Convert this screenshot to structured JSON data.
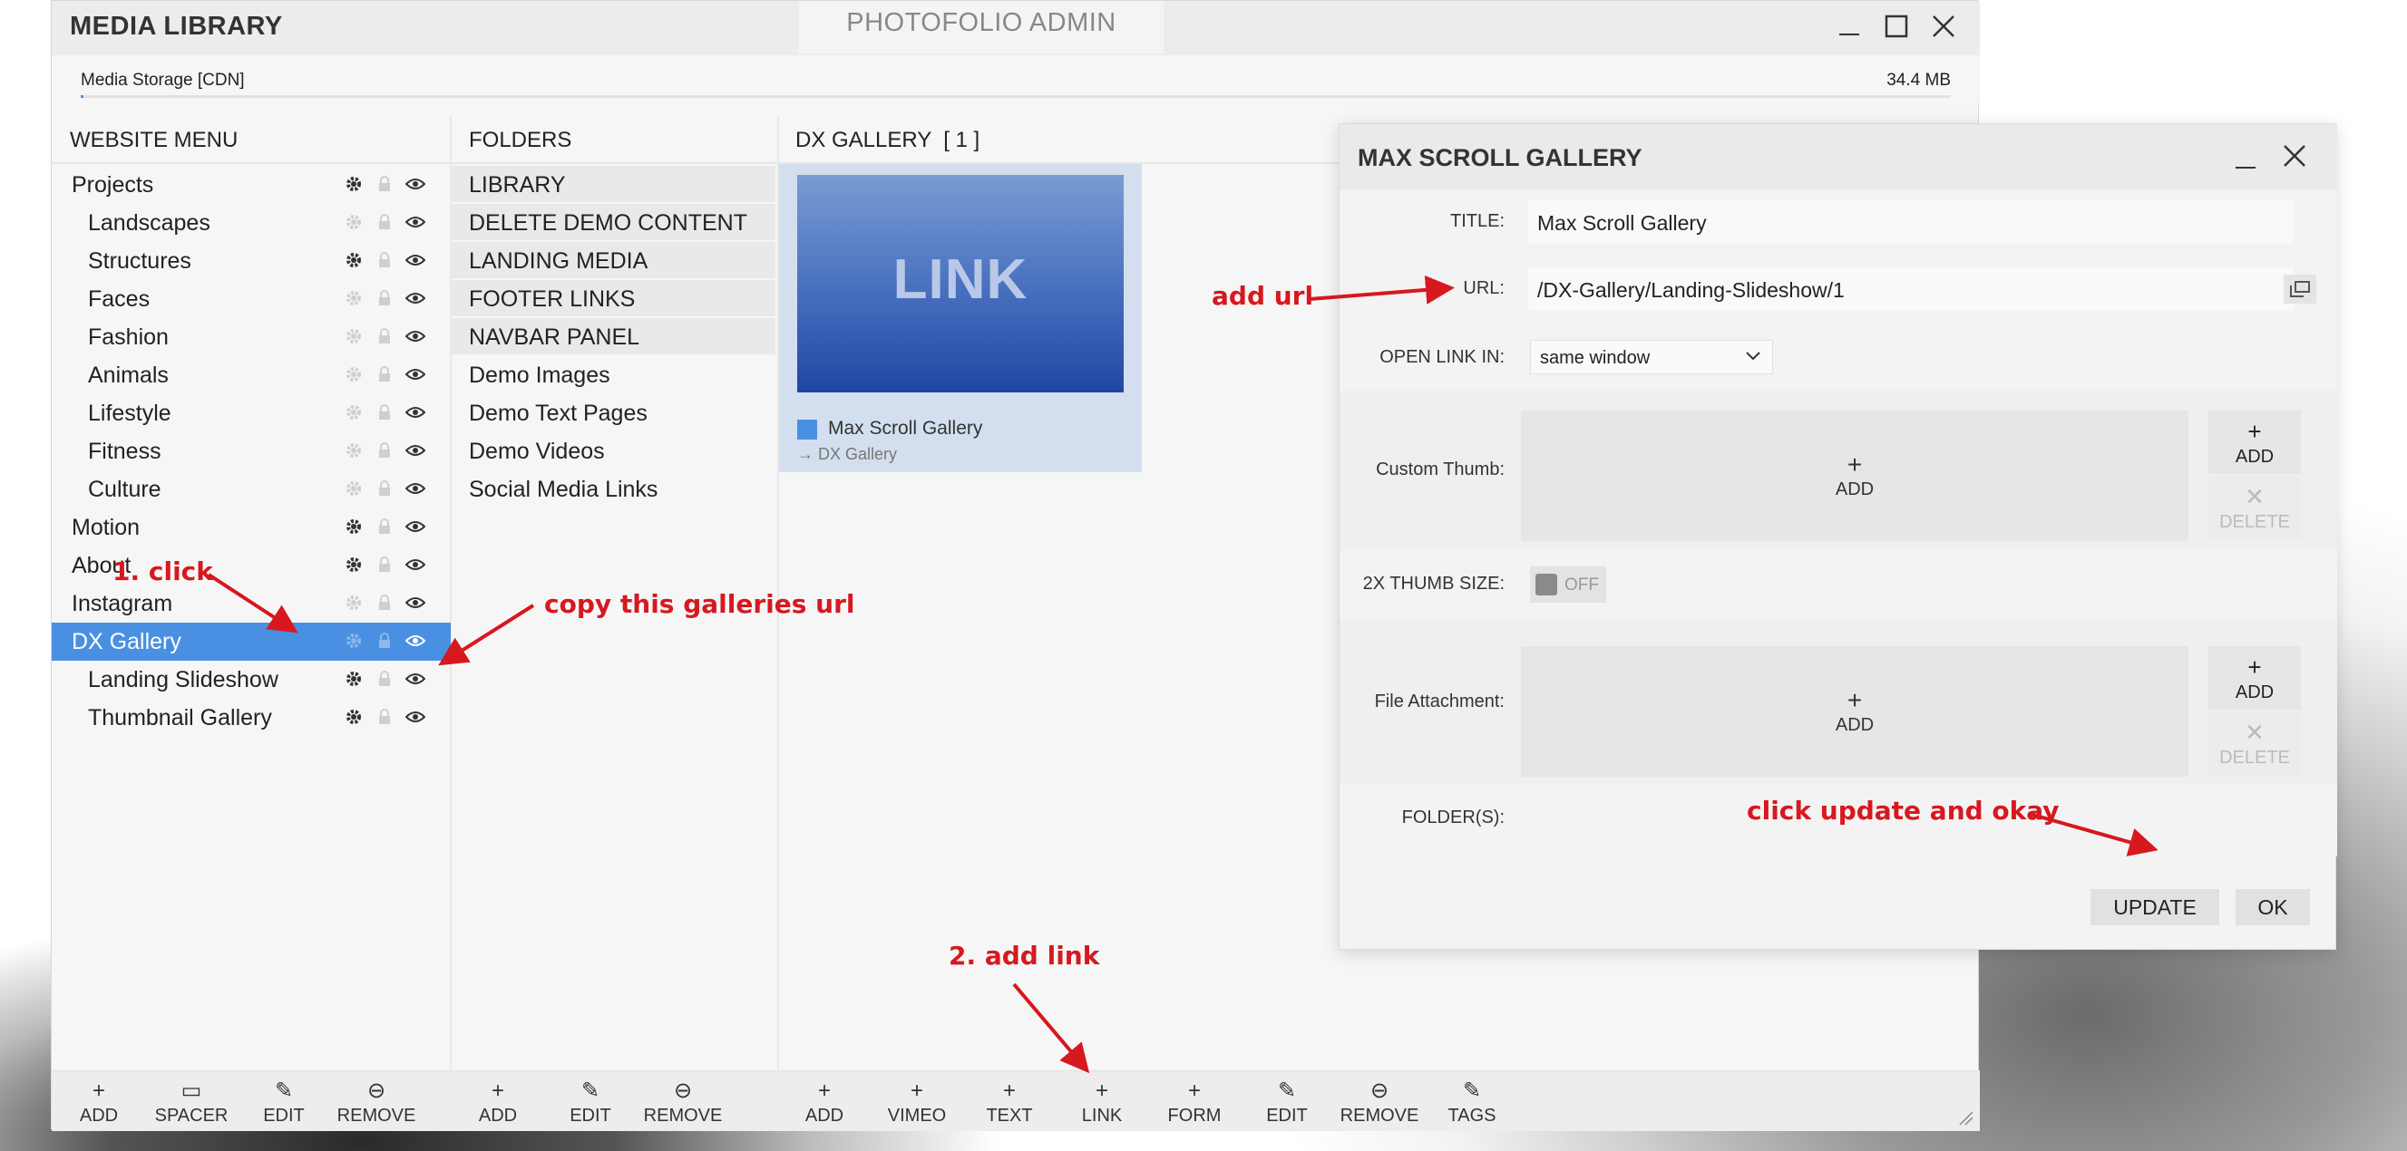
{
  "window": {
    "app_title": "MEDIA LIBRARY",
    "center_title": "PHOTOFOLIO ADMIN",
    "controls": {
      "minimize": "minimize-icon",
      "maximize": "maximize-icon",
      "close": "close-icon"
    }
  },
  "storage": {
    "label": "Media Storage [CDN]",
    "size": "34.4 MB",
    "used_fraction": 0.001
  },
  "website_menu": {
    "header": "WEBSITE MENU",
    "items": [
      {
        "label": "Projects",
        "level": 0,
        "gear_active": true
      },
      {
        "label": "Landscapes",
        "level": 1,
        "gear_active": false
      },
      {
        "label": "Structures",
        "level": 1,
        "gear_active": true
      },
      {
        "label": "Faces",
        "level": 1,
        "gear_active": false
      },
      {
        "label": "Fashion",
        "level": 1,
        "gear_active": false
      },
      {
        "label": "Animals",
        "level": 1,
        "gear_active": false
      },
      {
        "label": "Lifestyle",
        "level": 1,
        "gear_active": false
      },
      {
        "label": "Fitness",
        "level": 1,
        "gear_active": false
      },
      {
        "label": "Culture",
        "level": 1,
        "gear_active": false
      },
      {
        "label": "Motion",
        "level": 0,
        "gear_active": true
      },
      {
        "label": "About",
        "level": 0,
        "gear_active": true
      },
      {
        "label": "Instagram",
        "level": 0,
        "gear_active": false
      },
      {
        "label": "DX Gallery",
        "level": 0,
        "gear_active": false,
        "selected": true
      },
      {
        "label": "Landing Slideshow",
        "level": 1,
        "gear_active": true
      },
      {
        "label": "Thumbnail Gallery",
        "level": 1,
        "gear_active": true
      }
    ]
  },
  "folders": {
    "header": "FOLDERS",
    "system": [
      "LIBRARY",
      "DELETE DEMO CONTENT",
      "LANDING MEDIA",
      "FOOTER LINKS",
      "NAVBAR PANEL"
    ],
    "user": [
      "Demo Images",
      "Demo Text Pages",
      "Demo Videos",
      "Social Media Links"
    ]
  },
  "gallery": {
    "header": "DX GALLERY  [ 1 ]",
    "tile": {
      "thumb_text": "LINK",
      "title": "Max Scroll Gallery",
      "subtitle": "→ DX Gallery"
    }
  },
  "toolbar": {
    "menu": [
      {
        "icon": "+",
        "label": "ADD"
      },
      {
        "icon": "▭",
        "label": "SPACER"
      },
      {
        "icon": "✎",
        "label": "EDIT"
      },
      {
        "icon": "⊖",
        "label": "REMOVE"
      }
    ],
    "folders": [
      {
        "icon": "+",
        "label": "ADD"
      },
      {
        "icon": "✎",
        "label": "EDIT"
      },
      {
        "icon": "⊖",
        "label": "REMOVE"
      }
    ],
    "gallery": [
      {
        "icon": "+",
        "label": "ADD"
      },
      {
        "icon": "+",
        "label": "VIMEO"
      },
      {
        "icon": "+",
        "label": "TEXT"
      },
      {
        "icon": "+",
        "label": "LINK"
      },
      {
        "icon": "+",
        "label": "FORM"
      },
      {
        "icon": "✎",
        "label": "EDIT"
      },
      {
        "icon": "⊖",
        "label": "REMOVE"
      },
      {
        "icon": "✎",
        "label": "TAGS"
      }
    ]
  },
  "dialog": {
    "title": "MAX SCROLL GALLERY",
    "title_label": "TITLE:",
    "title_value": "Max Scroll Gallery",
    "url_label": "URL:",
    "url_value": "/DX-Gallery/Landing-Slideshow/1",
    "open_label": "OPEN LINK IN:",
    "open_value": "same window",
    "custom_thumb_label": "Custom Thumb:",
    "thumb_size_label": "2X THUMB SIZE:",
    "toggle_value": "OFF",
    "file_label": "File Attachment:",
    "folders_label": "FOLDER(S):",
    "add": "ADD",
    "delete": "DELETE",
    "plus": "+",
    "x": "✕",
    "update": "UPDATE",
    "ok": "OK"
  },
  "annotations": {
    "click": "1. click",
    "copy": "copy this galleries url",
    "add_link": "2. add link",
    "add_url": "add url",
    "update": "click update and okay"
  },
  "colors": {
    "accent": "#4a90e2",
    "annotation": "#d7181f"
  }
}
